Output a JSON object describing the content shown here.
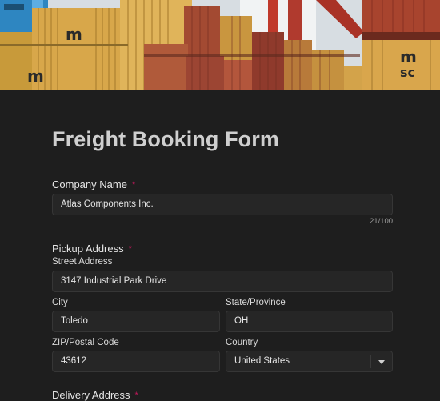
{
  "banner": {
    "alt": "Shipping containers at a port"
  },
  "form": {
    "title": "Freight Booking Form",
    "company": {
      "label": "Company Name",
      "required_mark": "*",
      "value": "Atlas Components Inc.",
      "counter": "21/100"
    },
    "pickup": {
      "label": "Pickup Address",
      "required_mark": "*",
      "street_label": "Street Address",
      "street_value": "3147 Industrial Park Drive",
      "city_label": "City",
      "city_value": "Toledo",
      "state_label": "State/Province",
      "state_value": "OH",
      "zip_label": "ZIP/Postal Code",
      "zip_value": "43612",
      "country_label": "Country",
      "country_value": "United States"
    },
    "delivery": {
      "label": "Delivery Address",
      "required_mark": "*"
    }
  },
  "colors": {
    "background": "#1e1e1e",
    "field_background": "#262626",
    "required": "#c2185b"
  },
  "icons": [
    "chevron-down-icon"
  ]
}
